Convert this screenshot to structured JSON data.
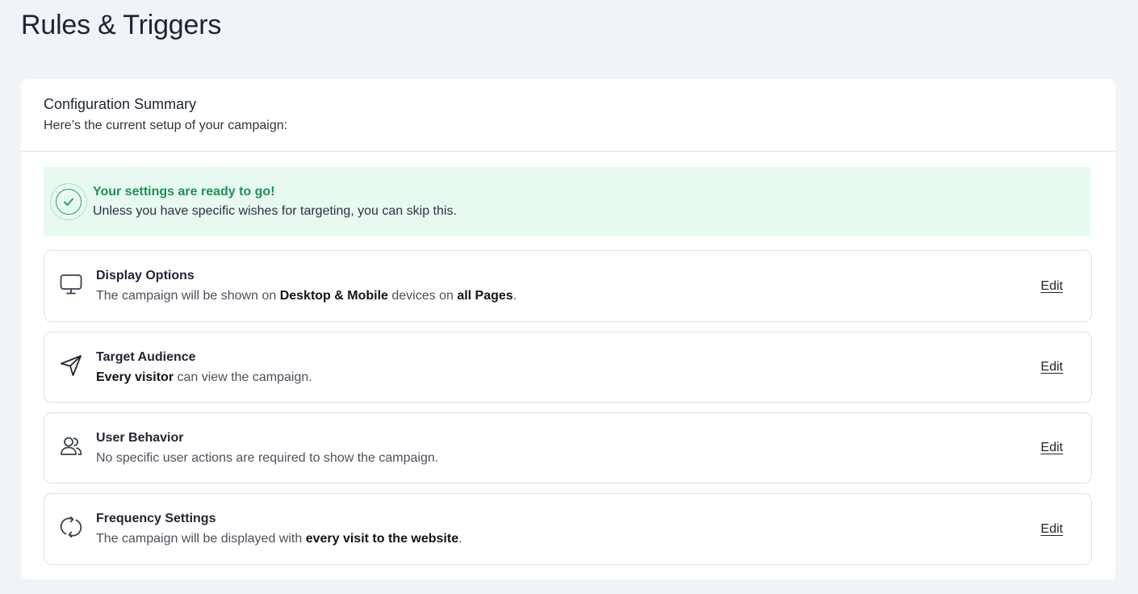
{
  "page": {
    "title": "Rules & Triggers"
  },
  "summary": {
    "title": "Configuration Summary",
    "subtitle": "Here’s the current setup of your campaign:"
  },
  "banner": {
    "icon": "check-circle-icon",
    "title": "Your settings are ready to go!",
    "body": "Unless you have specific wishes for targeting, you can skip this.",
    "color": "#1d9256",
    "background": "#e8faf0"
  },
  "sections": {
    "display": {
      "icon": "monitor-icon",
      "title": "Display Options",
      "desc_1": "The campaign will be shown on ",
      "desc_bold_1": "Desktop & Mobile",
      "desc_2": " devices on ",
      "desc_bold_2": "all Pages",
      "desc_3": ".",
      "edit_label": "Edit"
    },
    "audience": {
      "icon": "send-arrow-icon",
      "title": "Target Audience",
      "desc_bold_1": "Every visitor",
      "desc_1": " can view the campaign.",
      "edit_label": "Edit"
    },
    "behavior": {
      "icon": "users-icon",
      "title": "User Behavior",
      "desc_1": "No specific user actions are required to show the campaign.",
      "edit_label": "Edit"
    },
    "frequency": {
      "icon": "refresh-icon",
      "title": "Frequency Settings",
      "desc_1": "The campaign will be displayed with ",
      "desc_bold_1": "every visit to the website",
      "desc_2": ".",
      "edit_label": "Edit"
    }
  }
}
